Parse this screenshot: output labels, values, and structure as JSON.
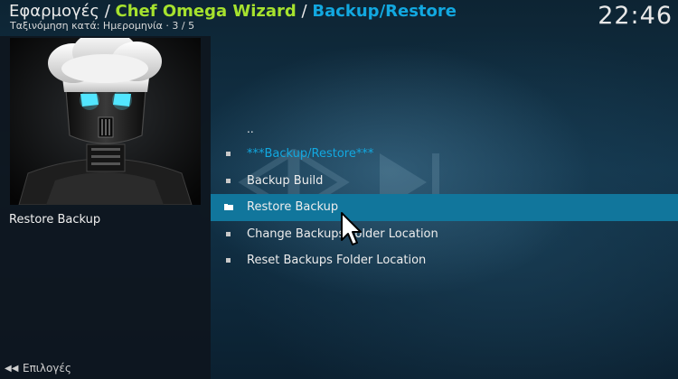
{
  "header": {
    "breadcrumb_root": "Εφαρμογές",
    "separator": "/",
    "breadcrumb_addon": "Chef Omega Wizard",
    "breadcrumb_page": "Backup/Restore",
    "sort_info": "Ταξινόμηση κατά: Ημερομηνία  ·  3 / 5",
    "clock": "22:46"
  },
  "left_panel": {
    "thumbnail_icon": "chef-robot-icon",
    "selected_title": "Restore Backup",
    "options_label": "Επιλογές"
  },
  "list": {
    "parent": "..",
    "items": [
      {
        "label": "***Backup/Restore***",
        "highlighted_text": true
      },
      {
        "label": "Backup Build"
      },
      {
        "label": "Restore Backup",
        "selected": true
      },
      {
        "label": "Change Backups Folder Location"
      },
      {
        "label": "Reset Backups Folder Location"
      }
    ]
  },
  "colors": {
    "accent_blue": "#12a8e0",
    "addon_green": "#a6e22e",
    "selection_bar": "#11769c"
  }
}
